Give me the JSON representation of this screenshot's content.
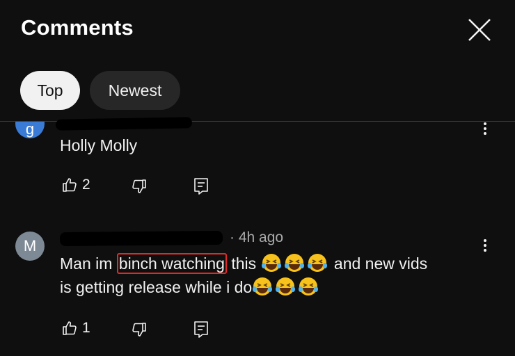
{
  "header": {
    "title": "Comments"
  },
  "filters": {
    "top_label": "Top",
    "newest_label": "Newest"
  },
  "comments": [
    {
      "avatar_letter": "g",
      "text": "Holly Molly",
      "likes": "2"
    },
    {
      "avatar_letter": "M",
      "time": "· 4h ago",
      "text_before": "Man im ",
      "text_highlight": "binch watching",
      "text_after_1": " this",
      "text_after_2": " and new vids",
      "text_line2": "is getting release while i do",
      "likes": "1"
    }
  ],
  "icons": [
    "close-icon",
    "more-vert-icon",
    "thumbs-up-icon",
    "thumbs-down-icon",
    "reply-icon",
    "laughing-emoji-icon"
  ],
  "colors": {
    "background": "#0f0f0f",
    "chip_active": "#f1f1f1",
    "chip_inactive": "#272727",
    "highlight": "#e02a2a",
    "avatar_g": "#3a7bd5",
    "avatar_m": "#7d8a96"
  }
}
